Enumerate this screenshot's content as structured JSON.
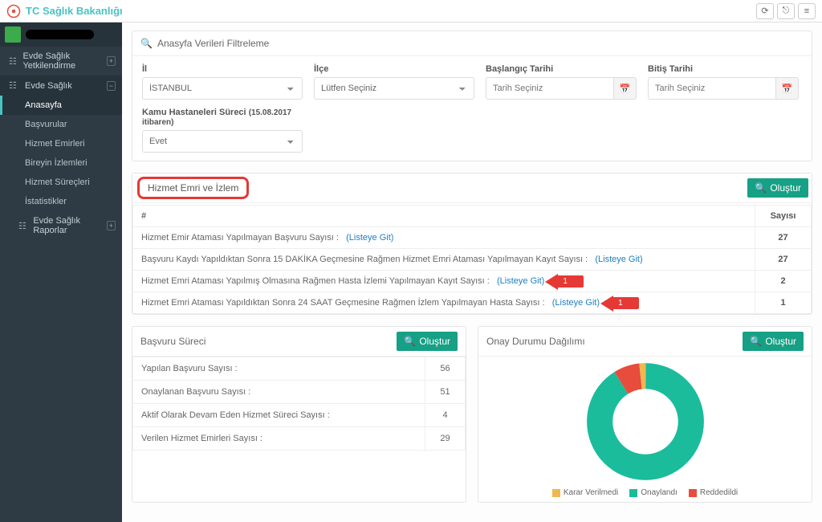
{
  "brand": "TC Sağlık Bakanlığı",
  "sidebar": {
    "yetki": {
      "label": "Evde Sağlık Yetkilendirme"
    },
    "evde": {
      "label": "Evde Sağlık"
    },
    "subs": [
      "Anasayfa",
      "Başvurular",
      "Hizmet Emirleri",
      "Bireyin İzlemleri",
      "Hizmet Süreçleri",
      "İstatistikler"
    ],
    "raporlar": "Evde Sağlık Raporlar"
  },
  "filter": {
    "header": "Anasyfa Verileri Filtreleme",
    "il_label": "İl",
    "il_value": "İSTANBUL",
    "ilce_label": "İlçe",
    "ilce_value": "Lütfen Seçiniz",
    "bas_label": "Başlangıç Tarihi",
    "bas_ph": "Tarih Seçiniz",
    "bit_label": "Bitiş Tarihi",
    "bit_ph": "Tarih Seçiniz",
    "kamu_label": "Kamu Hastaneleri Süreci",
    "kamu_note": "(15.08.2017 itibaren)",
    "kamu_value": "Evet"
  },
  "hizmet": {
    "title": "Hizmet Emri ve İzlem",
    "olustur": "Oluştur",
    "col_hash": "#",
    "col_say": "Sayısı",
    "link": "(Listeye Git)",
    "arrow_label": "1",
    "rows": [
      {
        "t": "Hizmet Emir Ataması Yapılmayan Başvuru Sayısı :",
        "v": "27",
        "arrow": false
      },
      {
        "t": "Başvuru Kaydı Yapıldıktan Sonra 15 DAKİKA Geçmesine Rağmen Hizmet Emri Ataması Yapılmayan Kayıt Sayısı :",
        "v": "27",
        "arrow": false
      },
      {
        "t": "Hizmet Emri Ataması Yapılmış Olmasına Rağmen Hasta İzlemi Yapılmayan Kayıt Sayısı :",
        "v": "2",
        "arrow": true
      },
      {
        "t": "Hizmet Emri Ataması Yapıldıktan Sonra 24 SAAT Geçmesine Rağmen İzlem Yapılmayan Hasta Sayısı :",
        "v": "1",
        "arrow": true
      }
    ]
  },
  "basvuru": {
    "title": "Başvuru Süreci",
    "rows": [
      {
        "t": "Yapılan Başvuru Sayısı :",
        "v": "56"
      },
      {
        "t": "Onaylanan Başvuru Sayısı :",
        "v": "51"
      },
      {
        "t": "Aktif Olarak Devam Eden Hizmet Süreci Sayısı :",
        "v": "4"
      },
      {
        "t": "Verilen Hizmet Emirleri Sayısı :",
        "v": "29"
      }
    ]
  },
  "onay": {
    "title": "Onay Durumu Dağılımı",
    "legend": [
      {
        "label": "Karar Verilmedi",
        "color": "#f0b84e"
      },
      {
        "label": "Onaylandı",
        "color": "#1abc9c"
      },
      {
        "label": "Reddedildi",
        "color": "#e74c3c"
      }
    ]
  },
  "chart_data": {
    "type": "pie",
    "title": "Onay Durumu Dağılımı",
    "series": [
      {
        "name": "Onaylandı",
        "value": 51,
        "color": "#1abc9c"
      },
      {
        "name": "Reddedildi",
        "value": 4,
        "color": "#e74c3c"
      },
      {
        "name": "Karar Verilmedi",
        "value": 1,
        "color": "#f0b84e"
      }
    ]
  }
}
